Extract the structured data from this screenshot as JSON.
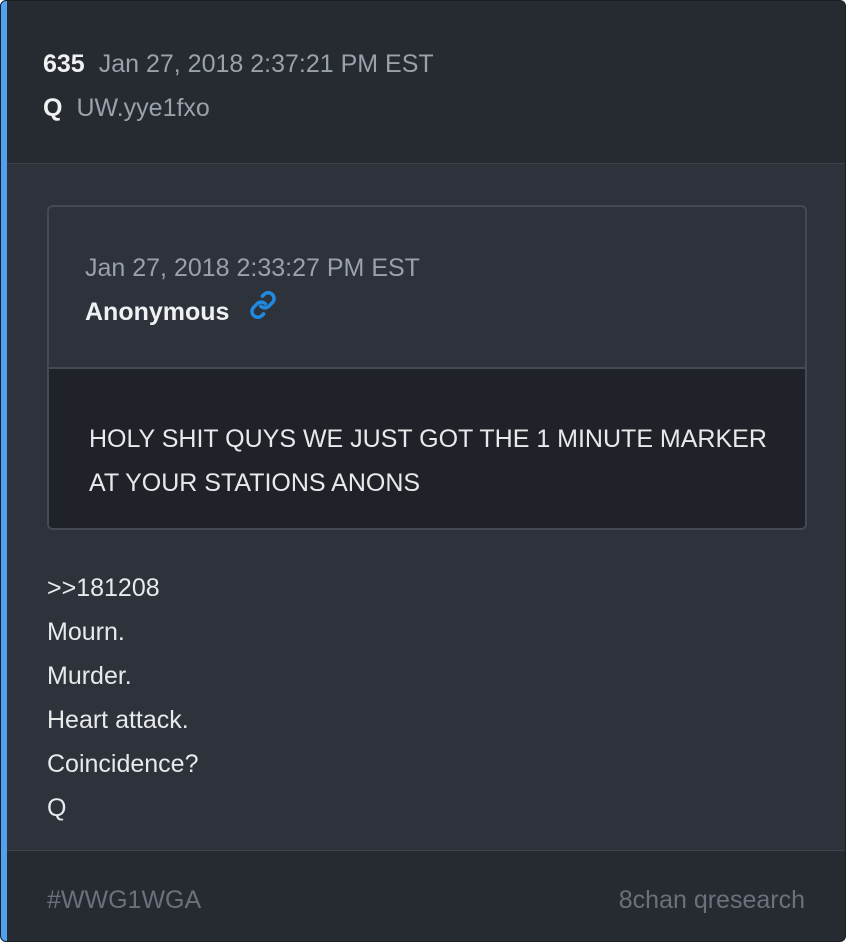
{
  "post": {
    "number": "635",
    "date": "Jan 27, 2018 2:37:21 PM EST",
    "author": "Q",
    "tripcode": "UW.yye1fxo"
  },
  "quote": {
    "date": "Jan 27, 2018 2:33:27 PM EST",
    "author": "Anonymous",
    "link_icon": "link-icon",
    "text": "HOLY SHIT QUYS WE JUST GOT THE 1 MINUTE MARKER AT YOUR STATIONS ANONS"
  },
  "body": {
    "lines": [
      ">>181208",
      "Mourn.",
      "Murder.",
      "Heart attack.",
      "Coincidence?",
      "Q"
    ]
  },
  "footer": {
    "hashtag": "#WWG1WGA",
    "source": "8chan qresearch"
  },
  "colors": {
    "accent": "#4ea2f0",
    "link": "#1f8ae0",
    "background": "#2d323b",
    "header_background": "#262a31"
  }
}
